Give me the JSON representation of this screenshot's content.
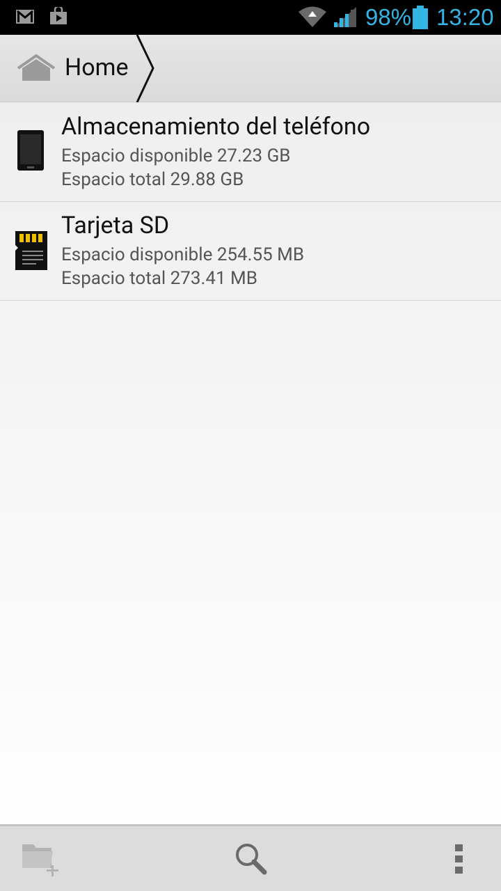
{
  "status_bar": {
    "battery_percent": "98%",
    "time": "13:20",
    "icons": [
      "gmail-icon",
      "play-store-icon",
      "wifi-icon",
      "signal-icon",
      "battery-icon"
    ],
    "accent_color": "#33b5e5"
  },
  "breadcrumb": {
    "home_label": "Home",
    "icon": "home-icon"
  },
  "storage": [
    {
      "title": "Almacenamiento del teléfono",
      "available": "Espacio disponible 27.23 GB",
      "total": "Espacio total 29.88 GB",
      "icon": "phone-icon"
    },
    {
      "title": "Tarjeta SD",
      "available": "Espacio disponible 254.55 MB",
      "total": "Espacio total 273.41 MB",
      "icon": "sd-card-icon"
    }
  ],
  "actions": {
    "new_folder_icon": "new-folder-icon",
    "search_icon": "search-icon",
    "overflow_icon": "overflow-menu-icon"
  }
}
